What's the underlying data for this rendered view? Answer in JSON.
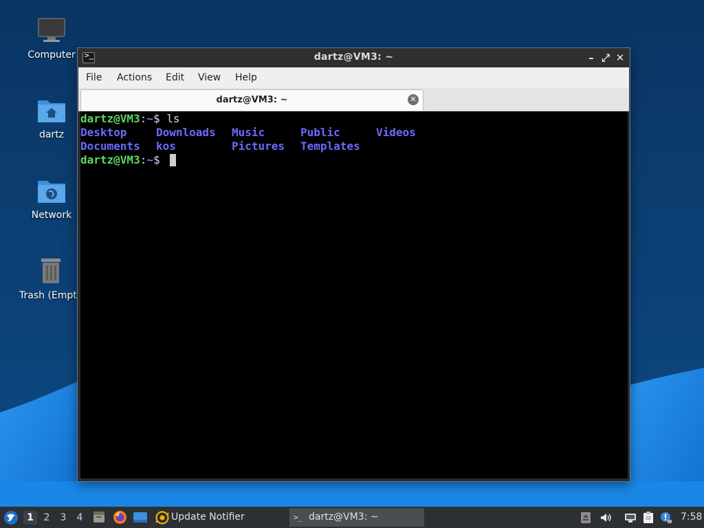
{
  "desktop": {
    "icons": [
      {
        "label": "Computer",
        "icon": "monitor-icon"
      },
      {
        "label": "dartz",
        "icon": "home-folder-icon"
      },
      {
        "label": "Network",
        "icon": "network-folder-icon"
      },
      {
        "label": "Trash (Empty)",
        "icon": "trash-icon"
      }
    ]
  },
  "window": {
    "title": "dartz@VM3: ~",
    "controls": {
      "minimize": "–",
      "maximize": "⤢",
      "close": "✕"
    },
    "menu": [
      "File",
      "Actions",
      "Edit",
      "View",
      "Help"
    ],
    "tab": {
      "label": "dartz@VM3: ~",
      "close": "✕"
    }
  },
  "terminal": {
    "line1": {
      "user": "dartz@VM3",
      "sep": ":",
      "path": "~",
      "prompt": "$ ",
      "command": "ls"
    },
    "ls_row1": [
      "Desktop",
      "Downloads",
      "Music",
      "Public",
      "Videos"
    ],
    "ls_row2": [
      "Documents",
      "kos",
      "Pictures",
      "Templates"
    ],
    "line3": {
      "user": "dartz@VM3",
      "sep": ":",
      "path": "~",
      "prompt": "$ "
    }
  },
  "taskbar": {
    "workspaces": [
      "1",
      "2",
      "3",
      "4"
    ],
    "active_workspace": "1",
    "update_notifier": "Update Notifier",
    "terminal_task": "dartz@VM3: ~",
    "clock": "7:58"
  },
  "colors": {
    "wallpaper_dark": "#0b3a68",
    "wallpaper_wave": "#1e88e5",
    "prompt_green": "#5fd75f",
    "dir_blue": "#6a6aff"
  }
}
